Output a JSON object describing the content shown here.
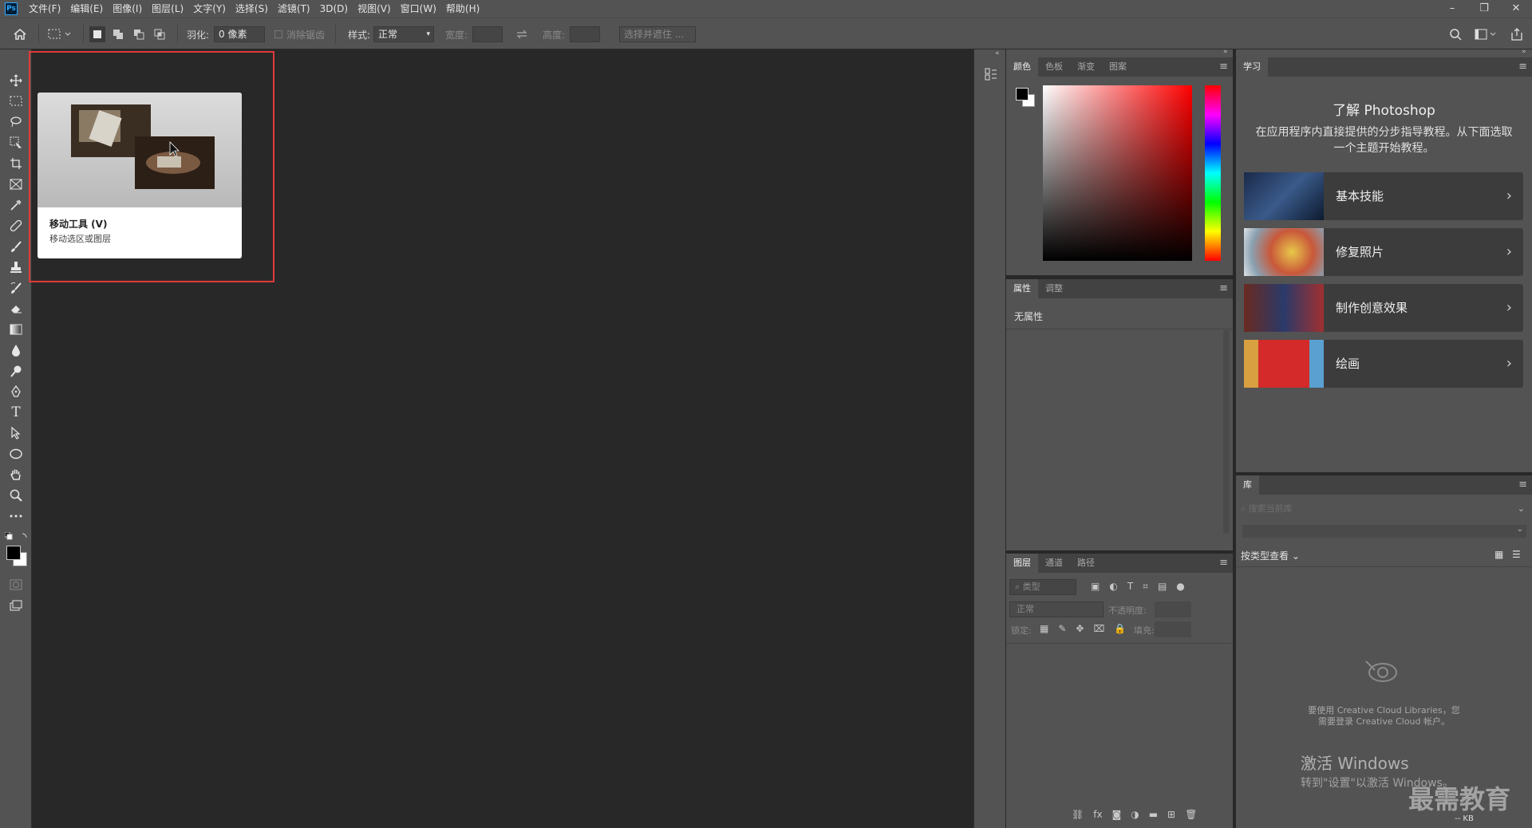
{
  "app": {
    "logo": "Ps"
  },
  "menu": [
    "文件(F)",
    "编辑(E)",
    "图像(I)",
    "图层(L)",
    "文字(Y)",
    "选择(S)",
    "滤镜(T)",
    "3D(D)",
    "视图(V)",
    "窗口(W)",
    "帮助(H)"
  ],
  "window_controls": {
    "minimize": "–",
    "restore": "❐",
    "close": "✕"
  },
  "options": {
    "feather_label": "羽化:",
    "feather_value": "0 像素",
    "antialias_label": "消除锯齿",
    "style_label": "样式:",
    "style_value": "正常",
    "width_label": "宽度:",
    "height_label": "高度:",
    "select_mask_button": "选择并遮住 ..."
  },
  "tooltip": {
    "title": "移动工具 (V)",
    "description": "移动选区或图层"
  },
  "color_panel": {
    "tabs": [
      "颜色",
      "色板",
      "渐变",
      "图案"
    ]
  },
  "properties_panel": {
    "tabs": [
      "属性",
      "调整"
    ],
    "empty_text": "无属性"
  },
  "layers_panel": {
    "tabs": [
      "图层",
      "通道",
      "路径"
    ],
    "filter_placeholder": "类型",
    "blend_mode": "正常",
    "opacity_label": "不透明度:",
    "lock_label": "锁定:",
    "fill_label": "填充:"
  },
  "learn_panel": {
    "tab": "学习",
    "heading": "了解 Photoshop",
    "subtext": "在应用程序内直接提供的分步指导教程。从下面选取一个主题开始教程。",
    "items": [
      {
        "label": "基本技能"
      },
      {
        "label": "修复照片"
      },
      {
        "label": "制作创意效果"
      },
      {
        "label": "绘画"
      }
    ]
  },
  "library_panel": {
    "tab": "库",
    "search_placeholder": "搜索当前库",
    "view_by": "按类型查看",
    "message_line1": "要使用 Creative Cloud Libraries，您",
    "message_line2": "需要登录 Creative Cloud 帐户。",
    "size": "-- KB"
  },
  "watermark": {
    "line1": "激活 Windows",
    "line2": "转到\"设置\"以激活 Windows。",
    "brand": "最需教育"
  }
}
